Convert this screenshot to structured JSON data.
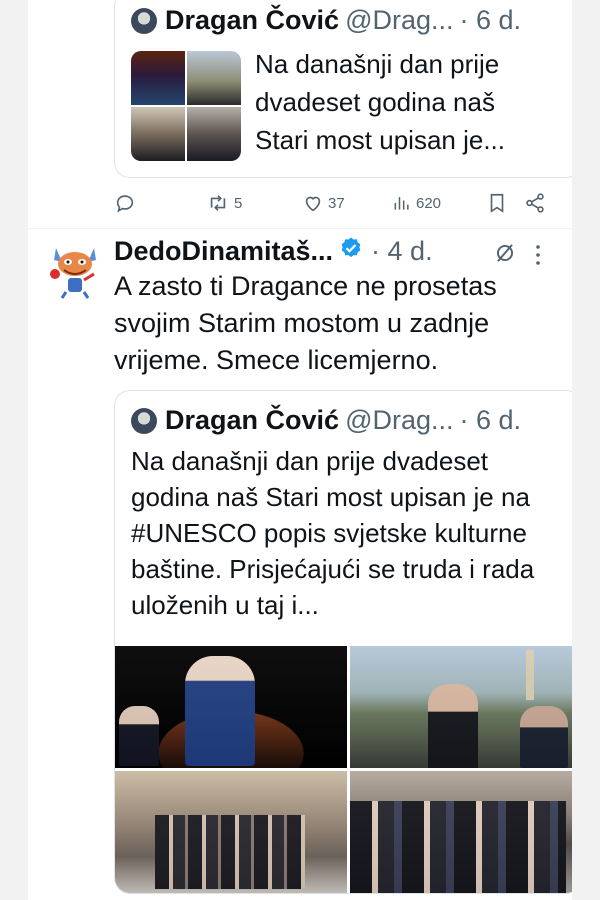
{
  "top_tweet": {
    "quote": {
      "author_name": "Dragan Čović",
      "author_handle": "@Drag...",
      "time": "· 6 d.",
      "text": "Na današnji dan prije dvadeset godina naš Stari most upisan je..."
    },
    "actions": {
      "reposts": "5",
      "likes": "37",
      "views": "620"
    }
  },
  "reply_tweet": {
    "author_name": "DedoDinamitaš...",
    "time": "· 4 d.",
    "text": "A zasto ti Dragance ne prosetas svojim Starim mostom u zadnje vrijeme. Smece licemjerno.",
    "quote": {
      "author_name": "Dragan Čović",
      "author_handle": "@Drag...",
      "time": "· 6 d.",
      "text": "Na današnji dan prije dvadeset godina naš Stari most upisan je na #UNESCO popis svjetske kulturne baštine. Prisjećajući se truda i rada uloženih u taj i..."
    }
  },
  "colors": {
    "text": "#0f1419",
    "muted": "#536471",
    "verified": "#1d9bf0",
    "border": "#dfe3e7"
  },
  "icons": [
    "reply-icon",
    "repost-icon",
    "like-icon",
    "views-icon",
    "bookmark-icon",
    "share-icon",
    "verified-badge-icon",
    "grok-icon",
    "more-icon"
  ]
}
